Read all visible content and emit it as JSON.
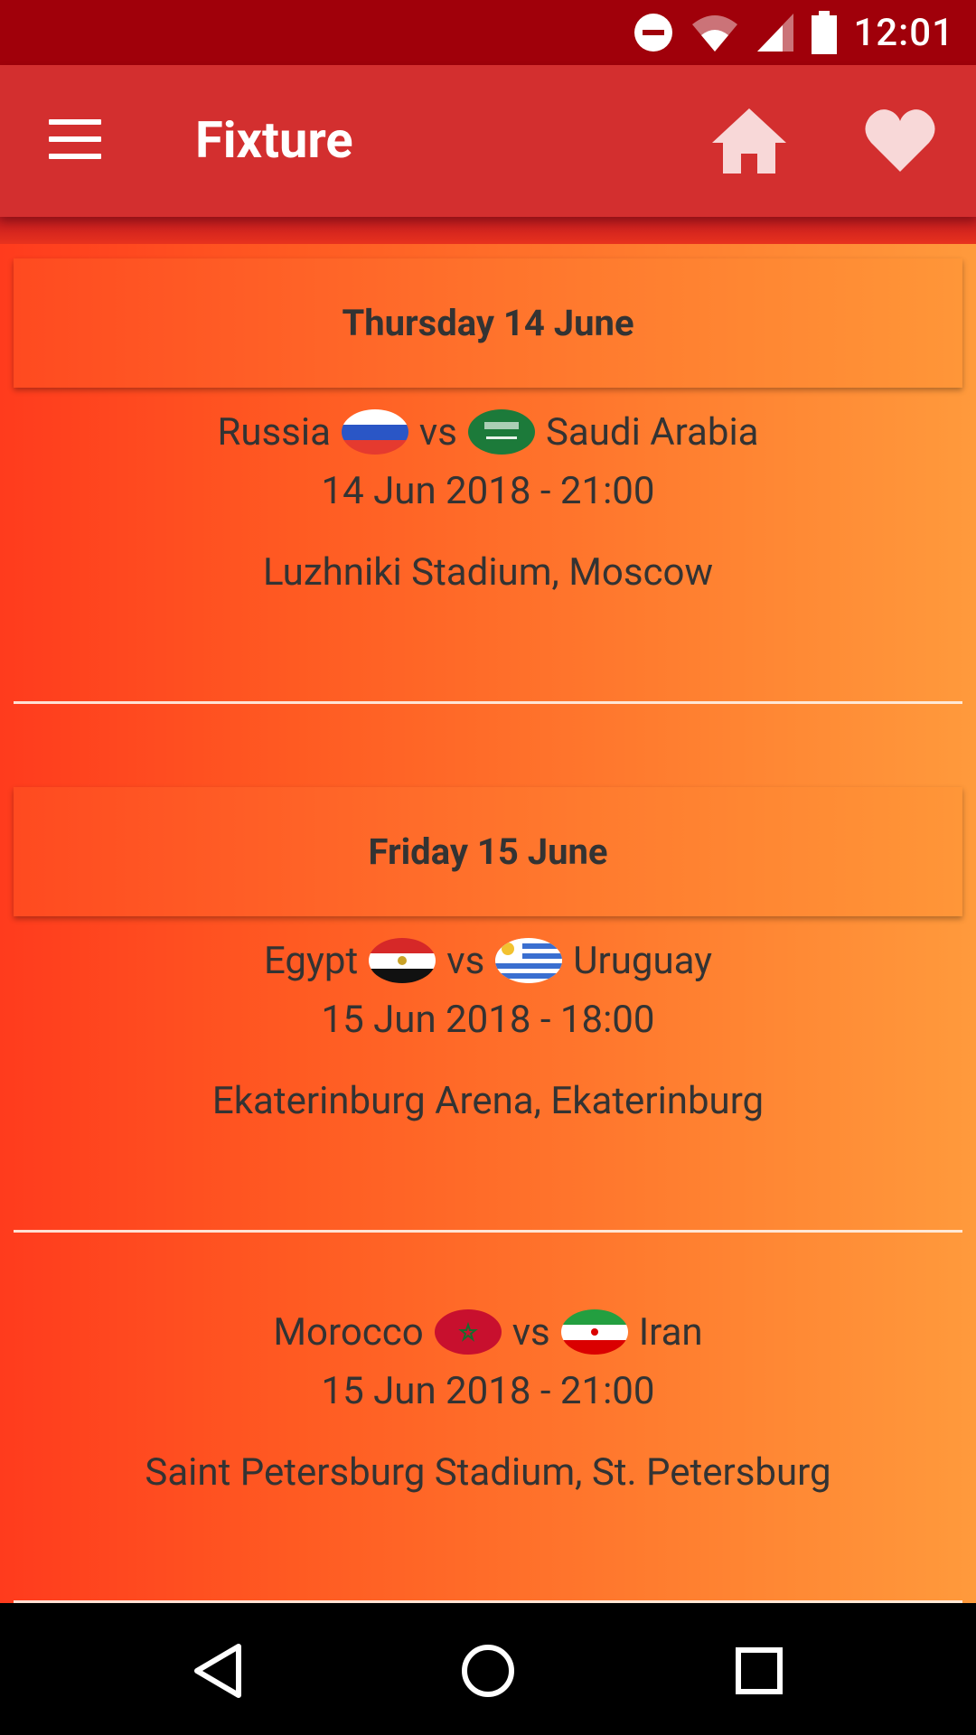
{
  "status_bar": {
    "time": "12:01",
    "icons": [
      "do-not-disturb-icon",
      "wifi-icon",
      "cellular-signal-icon",
      "battery-icon"
    ]
  },
  "app_bar": {
    "title": "Fixture",
    "menu_icon": "menu-icon",
    "home_icon": "home-icon",
    "favorite_icon": "heart-icon"
  },
  "days": [
    {
      "header": "Thursday 14 June",
      "matches": [
        {
          "home": "Russia",
          "away": "Saudi Arabia",
          "vs": "vs",
          "datetime": "14 Jun 2018 - 21:00",
          "venue": "Luzhniki Stadium, Moscow"
        }
      ]
    },
    {
      "header": "Friday 15 June",
      "matches": [
        {
          "home": "Egypt",
          "away": "Uruguay",
          "vs": "vs",
          "datetime": "15 Jun 2018 - 18:00",
          "venue": "Ekaterinburg Arena, Ekaterinburg"
        },
        {
          "home": "Morocco",
          "away": "Iran",
          "vs": "vs",
          "datetime": "15 Jun 2018 - 21:00",
          "venue": "Saint Petersburg Stadium, St. Petersburg"
        }
      ]
    }
  ],
  "nav_bar": {
    "icons": [
      "back-icon",
      "home-circle-icon",
      "recents-icon"
    ]
  },
  "colors": {
    "status_bar": "#a0000a",
    "app_bar": "#d32f2f",
    "gradient_start": "#ff3b1d",
    "gradient_end": "#ff9a3c",
    "text": "#333333"
  }
}
